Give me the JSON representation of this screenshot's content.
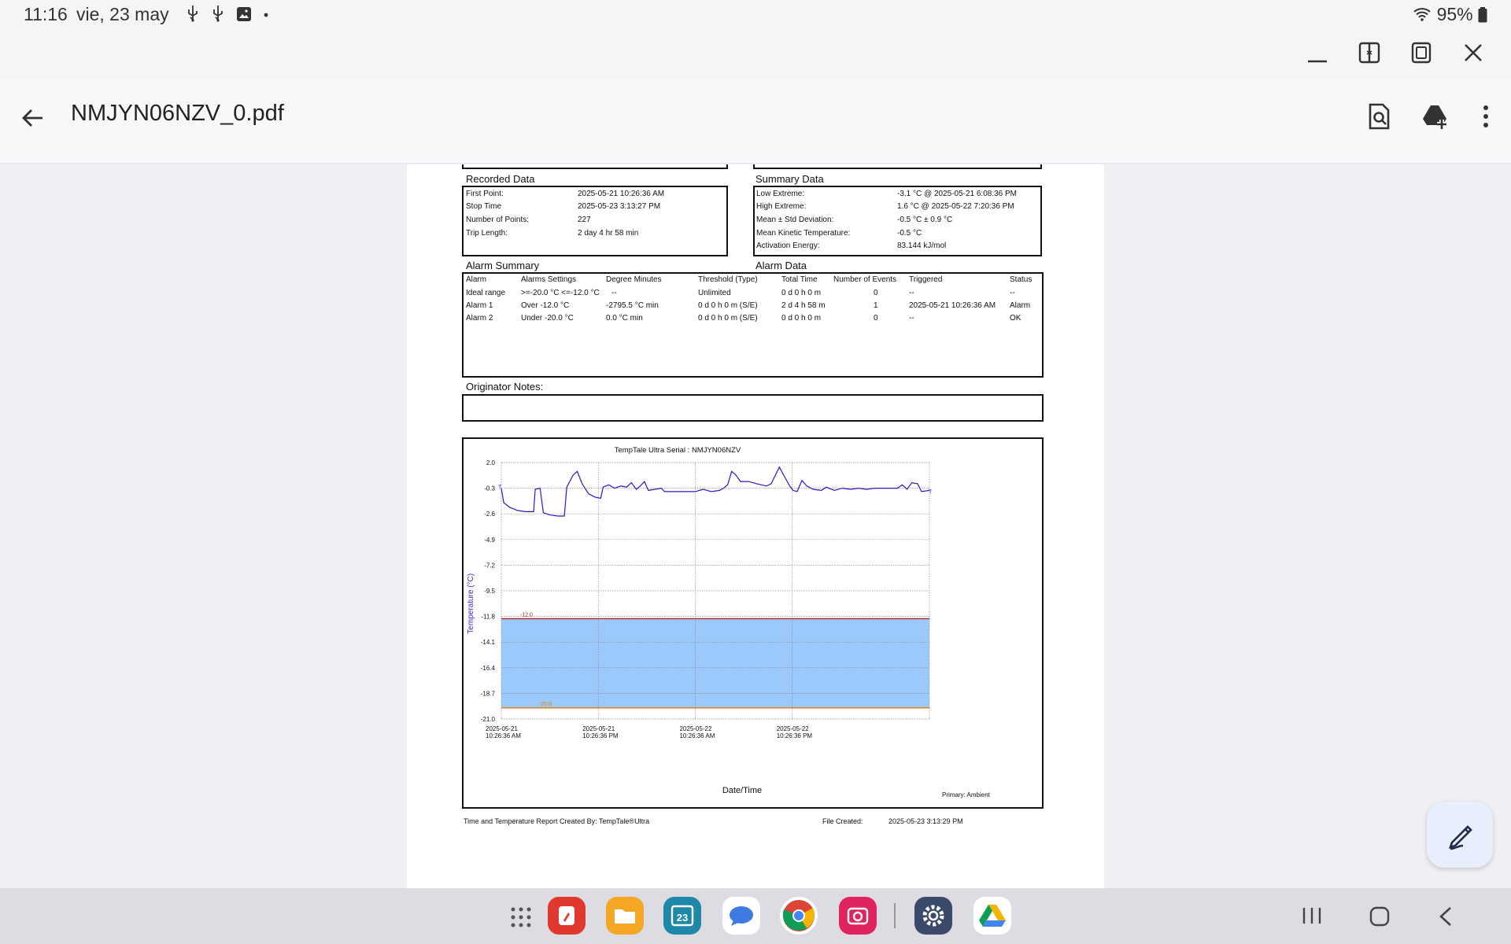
{
  "status_bar": {
    "time": "11:16",
    "date": "vie, 23 may",
    "battery": "95%"
  },
  "app_bar": {
    "title": "NMJYN06NZV_0.pdf"
  },
  "document": {
    "recorded_data": {
      "title": "Recorded Data",
      "rows": [
        {
          "label": "First Point:",
          "value": "2025-05-21 10:26:36 AM"
        },
        {
          "label": "Stop Time",
          "value": "2025-05-23  3:13:27 PM"
        },
        {
          "label": "Number of Points:",
          "value": "227"
        },
        {
          "label": "Trip Length:",
          "value": "2 day 4 hr 58 min"
        }
      ]
    },
    "summary_data": {
      "title": "Summary Data",
      "rows": [
        {
          "label": "Low Extreme:",
          "value": "-3.1 °C @ 2025-05-21  6:08:36 PM"
        },
        {
          "label": "High Extreme:",
          "value": "1.6 °C @ 2025-05-22  7:20:36 PM"
        },
        {
          "label": "Mean ± Std Deviation:",
          "value": "-0.5 °C ± 0.9 °C"
        },
        {
          "label": "Mean Kinetic Temperature:",
          "value": "-0.5 °C"
        },
        {
          "label": "Activation Energy:",
          "value": "83.144 kJ/mol"
        }
      ]
    },
    "alarm_summary": {
      "title": "Alarm Summary",
      "alarm_data_title": "Alarm Data",
      "headers": [
        "Alarm",
        "Alarms Settings",
        "Degree Minutes",
        "Threshold (Type)",
        "Total Time",
        "Number of Events",
        "Triggered",
        "Status"
      ],
      "rows": [
        [
          "Ideal range",
          ">=-20.0 °C <=-12.0 °C",
          "--",
          "Unlimited",
          "0 d 0 h 0 m",
          "0",
          "--",
          "--"
        ],
        [
          "Alarm 1",
          "Over -12.0 °C",
          "-2795.5 °C min",
          "0 d 0 h 0 m (S/E)",
          "2 d 4 h 58 m",
          "1",
          "2025-05-21 10:26:36 AM",
          "Alarm"
        ],
        [
          "Alarm 2",
          "Under -20.0 °C",
          "0.0 °C min",
          "0 d 0 h 0 m (S/E)",
          "0 d 0 h 0 m",
          "0",
          "--",
          "OK"
        ]
      ]
    },
    "originator_notes": {
      "title": "Originator Notes:"
    },
    "footer": {
      "created_by": "Time and Temperature Report Created By:  TempTale®Ultra",
      "file_created_label": "File Created:",
      "file_created_value": "2025-05-23  3:13:29 PM"
    }
  },
  "chart_data": {
    "type": "line",
    "title": "TempTale Ultra  Serial : NMJYN06NZV",
    "xlabel": "Date/Time",
    "ylabel": "Temperature   (°C)",
    "legend": "Primary: Ambient",
    "ylim": [
      -21.0,
      2.0
    ],
    "y_ticks": [
      "2.0",
      "-0.3",
      "-2.6",
      "-4.9",
      "-7.2",
      "-9.5",
      "-11.8",
      "-14.1",
      "-16.4",
      "-18.7",
      "-21.0"
    ],
    "x_ticks": [
      {
        "d": "2025-05-21",
        "t": "10:26:36 AM"
      },
      {
        "d": "2025-05-21",
        "t": "10:26:36 PM"
      },
      {
        "d": "2025-05-22",
        "t": "10:26:36 AM"
      },
      {
        "d": "2025-05-22",
        "t": "10:26:36 PM"
      }
    ],
    "xlim_hours": [
      0,
      52.97
    ],
    "thresholds": [
      {
        "label": "-12.0",
        "value": -12.0,
        "color": "#b22222"
      },
      {
        "label": "-20.0",
        "value": -20.0,
        "color": "#e07b00"
      }
    ],
    "band": {
      "low": -20.0,
      "high": -12.0,
      "color": "#9cc9fb"
    },
    "series": [
      {
        "color": "#2a18c8",
        "points": [
          [
            0,
            -0.3
          ],
          [
            0.3,
            -1.6
          ],
          [
            1,
            -2.0
          ],
          [
            2,
            -2.3
          ],
          [
            3,
            -2.4
          ],
          [
            4,
            -2.4
          ],
          [
            4.2,
            -0.4
          ],
          [
            4.8,
            -0.3
          ],
          [
            5.2,
            -2.5
          ],
          [
            6,
            -2.7
          ],
          [
            7,
            -2.8
          ],
          [
            7.8,
            -2.8
          ],
          [
            8.1,
            -0.2
          ],
          [
            8.9,
            0.9
          ],
          [
            9.4,
            1.2
          ],
          [
            10,
            0.1
          ],
          [
            10.8,
            -0.8
          ],
          [
            11.6,
            -1.1
          ],
          [
            12.3,
            -1.2
          ],
          [
            12.6,
            -0.2
          ],
          [
            13.3,
            0.0
          ],
          [
            14,
            -0.3
          ],
          [
            14.8,
            -0.1
          ],
          [
            15.5,
            -0.2
          ],
          [
            16.1,
            0.2
          ],
          [
            16.7,
            -0.4
          ],
          [
            17.2,
            -0.1
          ],
          [
            17.7,
            0.3
          ],
          [
            18.2,
            -0.5
          ],
          [
            19,
            -0.4
          ],
          [
            19.8,
            -0.3
          ],
          [
            20.2,
            -0.6
          ],
          [
            21,
            -0.6
          ],
          [
            22,
            -0.6
          ],
          [
            23,
            -0.6
          ],
          [
            24,
            -0.6
          ],
          [
            25,
            -0.4
          ],
          [
            26,
            -0.6
          ],
          [
            27,
            -0.5
          ],
          [
            27.5,
            -0.3
          ],
          [
            28,
            0.0
          ],
          [
            28.5,
            1.2
          ],
          [
            29,
            0.9
          ],
          [
            29.6,
            0.3
          ],
          [
            30.6,
            0.3
          ],
          [
            31.6,
            0.1
          ],
          [
            32.8,
            -0.1
          ],
          [
            33.4,
            0.1
          ],
          [
            34.4,
            1.6
          ],
          [
            35,
            0.8
          ],
          [
            35.6,
            0.0
          ],
          [
            36.1,
            -0.5
          ],
          [
            36.6,
            -0.6
          ],
          [
            37.2,
            0.4
          ],
          [
            37.8,
            -0.1
          ],
          [
            38.6,
            -0.4
          ],
          [
            39.6,
            -0.5
          ],
          [
            40.2,
            -0.2
          ],
          [
            41.2,
            -0.5
          ],
          [
            42.2,
            -0.3
          ],
          [
            43.2,
            -0.4
          ],
          [
            44.2,
            -0.3
          ],
          [
            45.2,
            -0.4
          ],
          [
            46.2,
            -0.3
          ],
          [
            47.2,
            -0.3
          ],
          [
            48.2,
            -0.3
          ],
          [
            49,
            -0.3
          ],
          [
            49.6,
            0.0
          ],
          [
            50.2,
            -0.4
          ],
          [
            50.8,
            0.2
          ],
          [
            51.5,
            0.1
          ],
          [
            52,
            -0.6
          ],
          [
            52.97,
            -0.5
          ]
        ]
      }
    ]
  }
}
